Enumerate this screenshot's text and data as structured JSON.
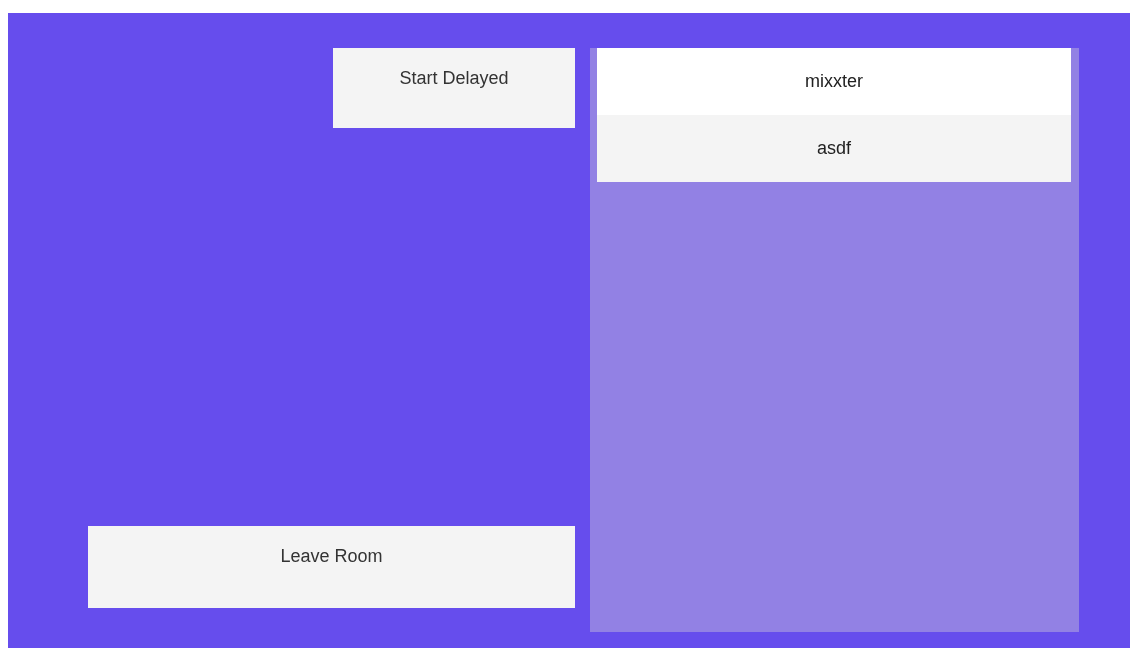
{
  "buttons": [
    {
      "kind": "start",
      "label": "Start Delayed"
    },
    {
      "kind": "leave",
      "label": "Leave Room"
    }
  ],
  "players": [
    {
      "name": "mixxter"
    },
    {
      "name": "asdf"
    }
  ]
}
